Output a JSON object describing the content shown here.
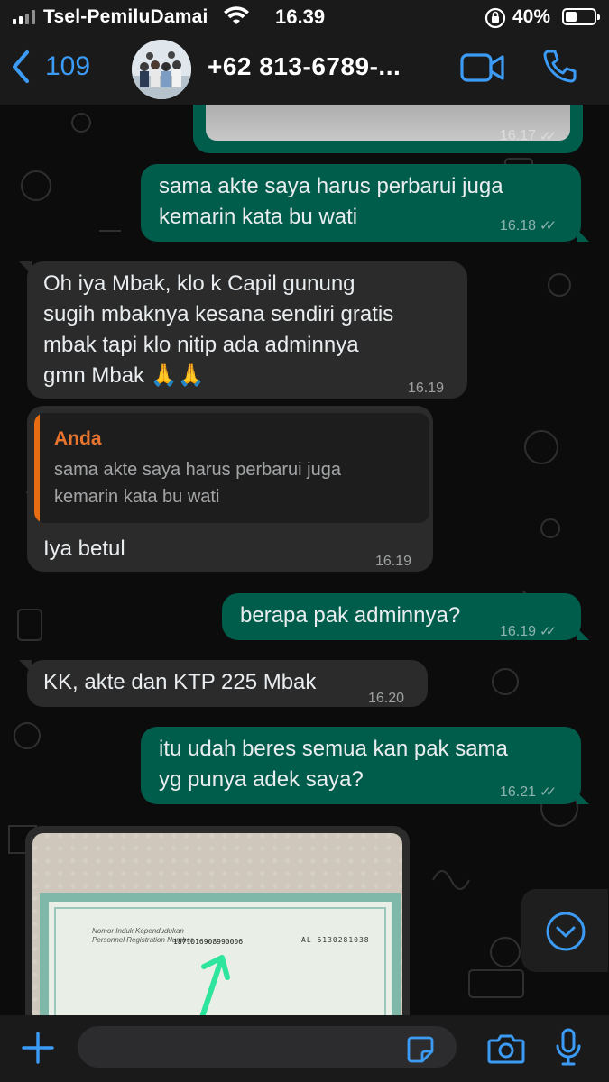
{
  "status_bar": {
    "carrier": "Tsel-PemiluDamai",
    "time": "16.39",
    "battery_percent": "40%",
    "battery_level": 0.4
  },
  "header": {
    "back_count": "109",
    "contact_name": "+62 813-6789-...",
    "icons": [
      "back-chevron-icon",
      "video-camera-icon",
      "phone-icon"
    ]
  },
  "messages": [
    {
      "direction": "out",
      "type": "image",
      "time": "16.17",
      "ticks": "✓✓"
    },
    {
      "direction": "out",
      "lines": [
        "sama akte saya harus perbarui juga",
        "kemarin kata bu wati"
      ],
      "time": "16.18",
      "ticks": "✓✓"
    },
    {
      "direction": "in",
      "lines": [
        "Oh iya Mbak, klo k Capil gunung",
        "sugih mbaknya kesana sendiri gratis",
        "mbak tapi klo nitip ada adminnya",
        "gmn Mbak 🙏🙏"
      ],
      "time": "16.19"
    },
    {
      "direction": "in",
      "quote": {
        "author": "Anda",
        "lines": [
          "sama akte saya harus perbarui juga",
          "kemarin kata bu wati"
        ]
      },
      "text": "Iya betul",
      "time": "16.19"
    },
    {
      "direction": "out",
      "text": "berapa pak adminnya?",
      "time": "16.19",
      "ticks": "✓✓"
    },
    {
      "direction": "in",
      "text": "KK, akte dan KTP 225 Mbak",
      "time": "16.20"
    },
    {
      "direction": "out",
      "lines": [
        "itu udah beres semua kan pak sama",
        "yg punya adek saya?"
      ],
      "time": "16.21",
      "ticks": "✓✓"
    },
    {
      "direction": "in",
      "type": "image",
      "document": {
        "label_line1": "Nomor Induk Kependudukan",
        "label_line2": "Personnel Registration Number",
        "number": "1871016908990006",
        "serial": "AL 6130281038"
      }
    }
  ],
  "input_bar": {
    "placeholder": "",
    "icons": [
      "plus-icon",
      "sticker-icon",
      "camera-icon",
      "microphone-icon"
    ]
  },
  "colors": {
    "outgoing_bubble": "#005c4b",
    "incoming_bubble": "#2b2b2b",
    "accent_blue": "#3b9bf5",
    "quote_orange": "#e8752d"
  }
}
